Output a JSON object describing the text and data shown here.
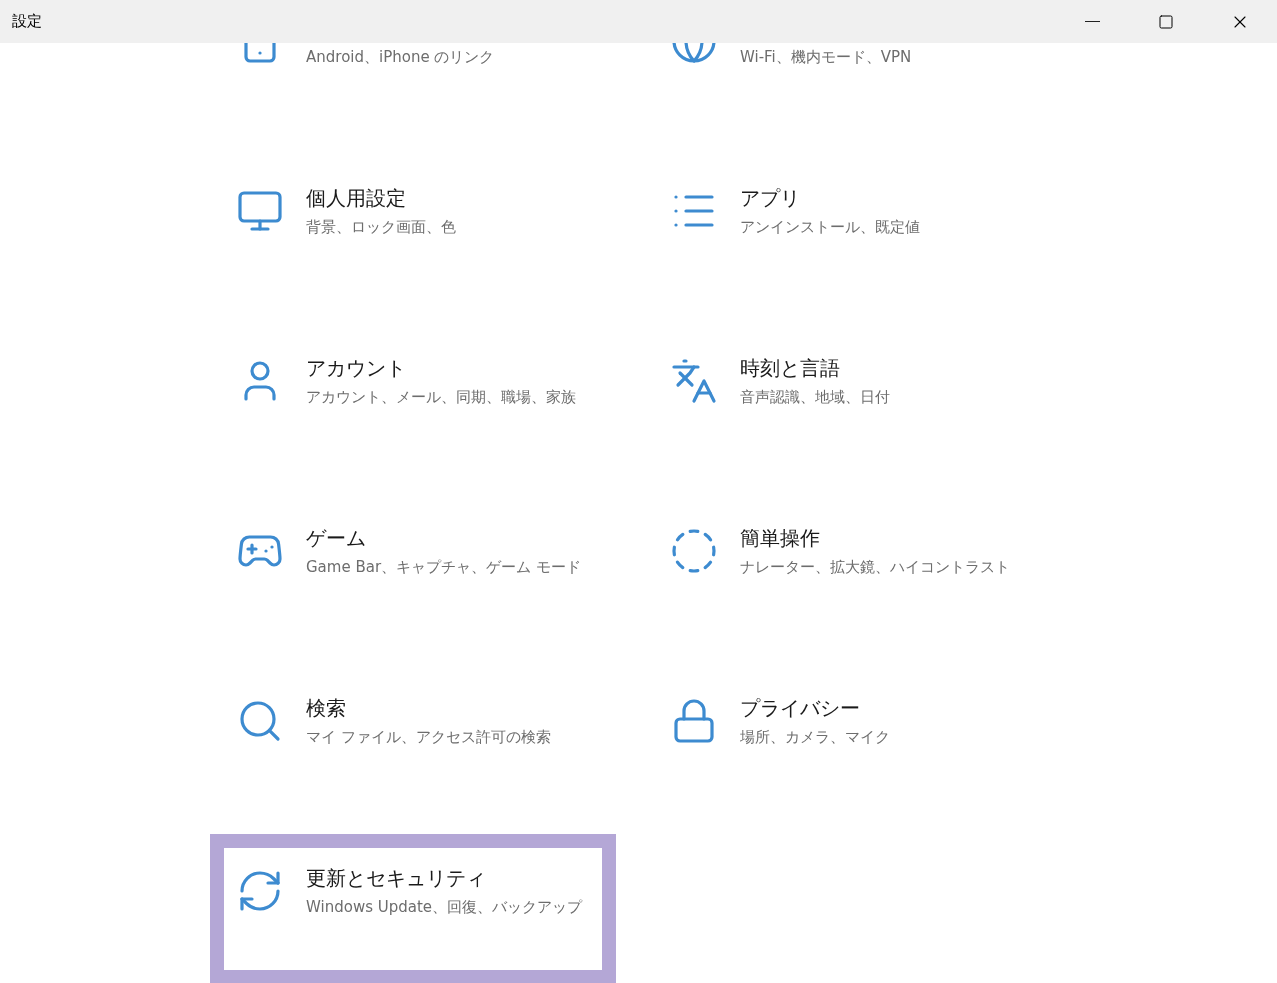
{
  "window": {
    "title": "設定"
  },
  "items": [
    {
      "subtitle": "Android、iPhone のリンク",
      "selected": false
    },
    {
      "subtitle": "Wi-Fi、機内モード、VPN",
      "selected": false
    },
    {
      "title": "個人用設定",
      "subtitle": "背景、ロック画面、色",
      "selected": false
    },
    {
      "title": "アプリ",
      "subtitle": "アンインストール、既定値",
      "selected": false
    },
    {
      "title": "アカウント",
      "subtitle": "アカウント、メール、同期、職場、家族",
      "selected": false
    },
    {
      "title": "時刻と言語",
      "subtitle": "音声認識、地域、日付",
      "selected": false
    },
    {
      "title": "ゲーム",
      "subtitle": "Game Bar、キャプチャ、ゲーム モード",
      "selected": false
    },
    {
      "title": "簡単操作",
      "subtitle": "ナレーター、拡大鏡、ハイコントラスト",
      "selected": false
    },
    {
      "title": "検索",
      "subtitle": "マイ ファイル、アクセス許可の検索",
      "selected": false
    },
    {
      "title": "プライバシー",
      "subtitle": "場所、カメラ、マイク",
      "selected": false
    },
    {
      "title": "更新とセキュリティ",
      "subtitle": "Windows Update、回復、バックアップ",
      "selected": true
    }
  ]
}
